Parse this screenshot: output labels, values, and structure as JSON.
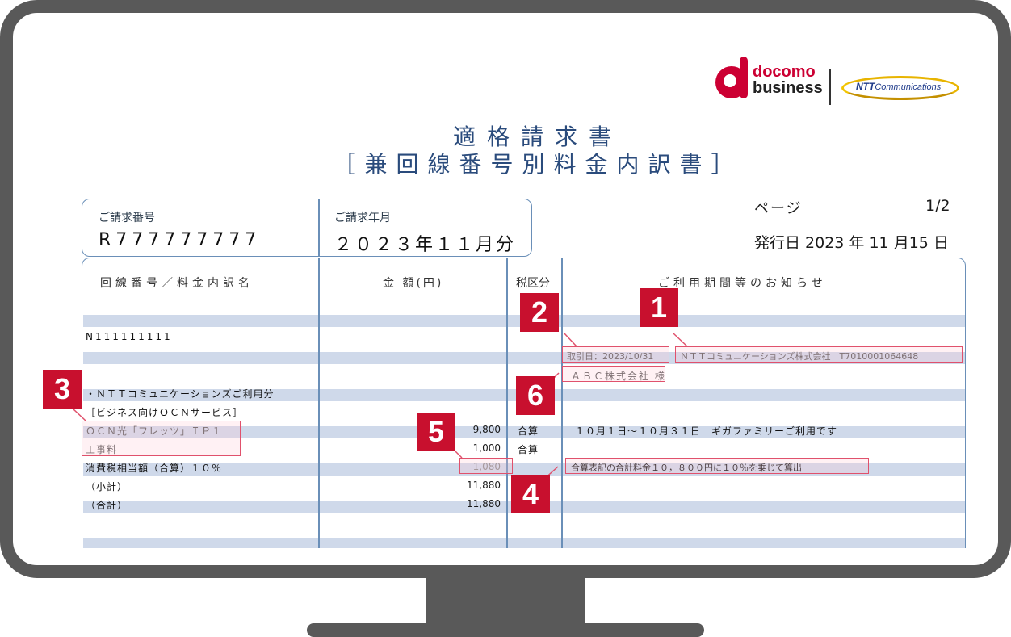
{
  "logos": {
    "docomo_line1": "docomo",
    "docomo_line2": "business",
    "ntt_brand": "NTT",
    "ntt_suffix": "Communications"
  },
  "title": {
    "line1": "適格請求書",
    "line2": "［兼回線番号別料金内訳書］"
  },
  "info": {
    "invoice_no_label": "ご請求番号",
    "invoice_no": "R777777777",
    "billing_month_label": "ご請求年月",
    "billing_month": "２０２３年１１月分",
    "page_label": "ページ",
    "page_value": "1/2",
    "issue_date": "発行日 2023 年 11 月15 日"
  },
  "table": {
    "headers": {
      "item": "回線番号／料金内訳名",
      "amount": "金 額(円)",
      "tax": "税区分",
      "notes": "ご利用期間等のお知らせ"
    },
    "line_no": "N111111111",
    "transaction_date": "取引日：2023/10/31",
    "issuer": "ＮＴＴコミュニケーションズ株式会社　T7010001064648",
    "customer": "ＡＢＣ株式会社 様",
    "section1": "・ＮＴＴコミュニケーションズご利用分",
    "section2": "［ビジネス向けＯＣＮサービス］",
    "rows": [
      {
        "name": "ＯＣＮ光「フレッツ」ＩＰ１",
        "amount": "9,800",
        "tax": "合算",
        "note": "１０月１日～１０月３１日　ギガファミリーご利用です"
      },
      {
        "name": "工事料",
        "amount": "1,000",
        "tax": "合算",
        "note": ""
      },
      {
        "name": "消費税相当額（合算）１０％",
        "amount": "1,080",
        "tax": "",
        "note": "合算表記の合計料金１０，８００円に１０％を乗じて算出"
      },
      {
        "name": "（小計）",
        "amount": "11,880",
        "tax": "",
        "note": ""
      },
      {
        "name": "（合計）",
        "amount": "11,880",
        "tax": "",
        "note": ""
      }
    ]
  },
  "callouts": [
    "1",
    "2",
    "3",
    "4",
    "5",
    "6"
  ],
  "colors": {
    "frame": "#595959",
    "accent_red": "#c8102e",
    "border_blue": "#6a8fb8",
    "stripe": "#cfd9ea"
  }
}
